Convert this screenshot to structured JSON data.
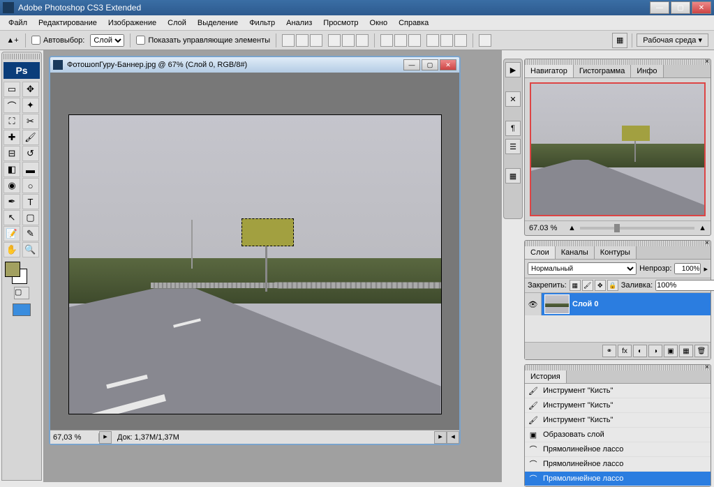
{
  "app": {
    "title": "Adobe Photoshop CS3 Extended"
  },
  "menu": [
    "Файл",
    "Редактирование",
    "Изображение",
    "Слой",
    "Выделение",
    "Фильтр",
    "Анализ",
    "Просмотр",
    "Окно",
    "Справка"
  ],
  "options": {
    "autoselect_label": "Автовыбор:",
    "autoselect_value": "Слой",
    "show_controls_label": "Показать управляющие элементы",
    "workspace_label": "Рабочая среда"
  },
  "document": {
    "title": "ФотошопГуру-Баннер.jpg @ 67% (Слой 0, RGB/8#)",
    "zoom": "67,03 %",
    "docsize": "Док: 1,37M/1,37M"
  },
  "navigator": {
    "tabs": [
      "Навигатор",
      "Гистограмма",
      "Инфо"
    ],
    "zoom": "67.03 %"
  },
  "layers": {
    "tabs": [
      "Слои",
      "Каналы",
      "Контуры"
    ],
    "blend_mode": "Нормальный",
    "opacity_label": "Непрозр:",
    "opacity_value": "100%",
    "lock_label": "Закрепить:",
    "fill_label": "Заливка:",
    "fill_value": "100%",
    "layer0": "Слой 0"
  },
  "history": {
    "tab": "История",
    "items": [
      "Инструмент \"Кисть\"",
      "Инструмент \"Кисть\"",
      "Инструмент \"Кисть\"",
      "Образовать слой",
      "Прямолинейное лассо",
      "Прямолинейное лассо",
      "Прямолинейное лассо"
    ]
  },
  "colors": {
    "foreground": "#a2a060",
    "background": "#ffffff"
  }
}
